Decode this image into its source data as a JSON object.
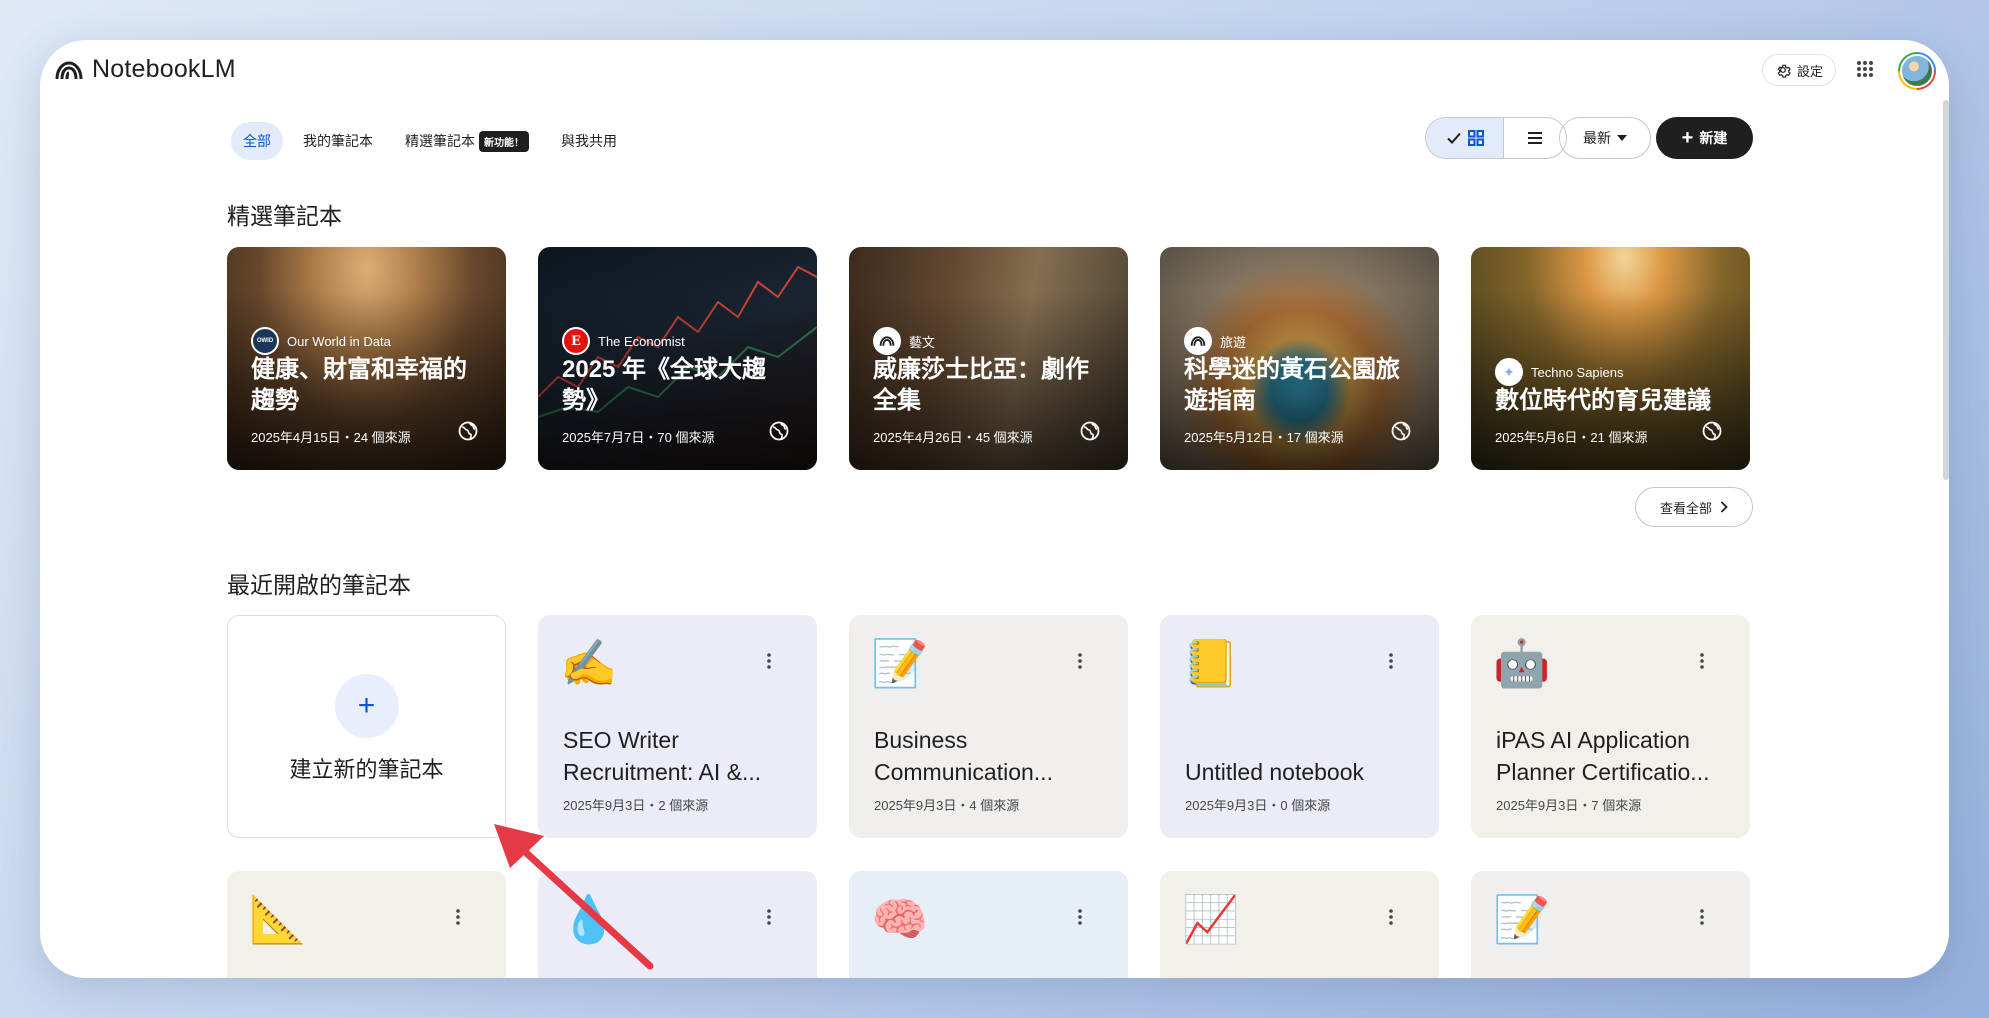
{
  "app": {
    "name": "NotebookLM",
    "settings_label": "設定"
  },
  "tabs": [
    {
      "label": "全部",
      "active": true
    },
    {
      "label": "我的筆記本",
      "active": false
    },
    {
      "label": "精選筆記本",
      "badge": "新功能！",
      "active": false
    },
    {
      "label": "與我共用",
      "active": false
    }
  ],
  "toolbar": {
    "sort_label": "最新",
    "new_label": "新建"
  },
  "featured": {
    "title": "精選筆記本",
    "see_all": "查看全部",
    "cards": [
      {
        "source": "Our World in Data",
        "source_logo": "Our World in Data",
        "title": "健康、財富和幸福的趨勢",
        "meta": "2025年4月15日・24 個來源",
        "bg": "#7a5a3a",
        "logo_bg": "#1d3557"
      },
      {
        "source": "The Economist",
        "source_logo": "E",
        "title": "2025 年《全球大趨勢》",
        "meta": "2025年7月7日・70 個來源",
        "bg": "#16202b",
        "logo_bg": "#e3120b"
      },
      {
        "source": "藝文",
        "source_logo": "notebooklm-logo",
        "title": "威廉莎士比亞：劇作全集",
        "meta": "2025年4月26日・45 個來源",
        "bg": "#5b4632",
        "logo_bg": "#ffffff"
      },
      {
        "source": "旅遊",
        "source_logo": "notebooklm-logo",
        "title": "科學迷的黃石公園旅遊指南",
        "meta": "2025年5月12日・17 個來源",
        "bg": "#8a6b48",
        "logo_bg": "#ffffff"
      },
      {
        "source": "Techno Sapiens",
        "source_logo": "techno-sapiens-logo",
        "title": "數位時代的育兒建議",
        "meta": "2025年5月6日・21 個來源",
        "bg": "#9a6a2a",
        "logo_bg": "#ffffff"
      }
    ]
  },
  "recent": {
    "title": "最近開啟的筆記本",
    "create_label": "建立新的筆記本",
    "cards": [
      {
        "emoji": "✍️",
        "title": "SEO Writer Recruitment: AI &...",
        "meta": "2025年9月3日・2 個來源",
        "bg": "#eaedf8"
      },
      {
        "emoji": "📝",
        "title": "Business Communication...",
        "meta": "2025年9月3日・4 個來源",
        "bg": "#f1efee"
      },
      {
        "emoji": "📒",
        "title": "Untitled notebook",
        "meta": "2025年9月3日・0 個來源",
        "bg": "#eaedf8"
      },
      {
        "emoji": "🤖",
        "title": "iPAS AI Application Planner Certificatio...",
        "meta": "2025年9月3日・7 個來源",
        "bg": "#f3f0ec"
      }
    ],
    "row2": [
      {
        "emoji": "📐",
        "bg": "#f3f0ea"
      },
      {
        "emoji": "💧",
        "bg": "#eaedf8"
      },
      {
        "emoji": "🧠",
        "bg": "#e6eef8"
      },
      {
        "emoji": "📈",
        "bg": "#f3f0ec"
      },
      {
        "emoji": "📝",
        "bg": "#f1efee"
      }
    ]
  },
  "colors": {
    "accent": "#0b57d0",
    "annotation_arrow": "#e53946"
  }
}
